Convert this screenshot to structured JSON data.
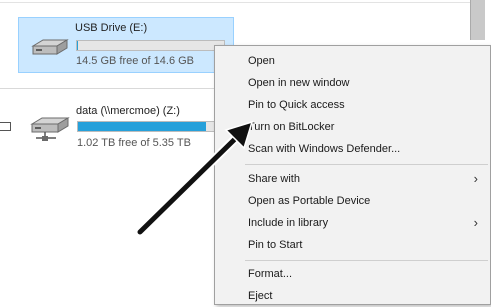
{
  "drives": [
    {
      "name": "USB Drive (E:)",
      "free_text": "14.5 GB free of 14.6 GB",
      "used_fraction": 0.01,
      "selected": true
    },
    {
      "name": "data (\\\\mercmoe) (Z:)",
      "free_text": "1.02 TB free of 5.35 TB",
      "used_fraction": 0.81,
      "selected": false
    }
  ],
  "context_menu": {
    "items": [
      {
        "label": "Open",
        "has_submenu": false
      },
      {
        "label": "Open in new window",
        "has_submenu": false
      },
      {
        "label": "Pin to Quick access",
        "has_submenu": false
      },
      {
        "label": "Turn on BitLocker",
        "has_submenu": false
      },
      {
        "label": "Scan with Windows Defender...",
        "has_submenu": false
      },
      {
        "label": "Share with",
        "has_submenu": true
      },
      {
        "label": "Open as Portable Device",
        "has_submenu": false
      },
      {
        "label": "Include in library",
        "has_submenu": true
      },
      {
        "label": "Pin to Start",
        "has_submenu": false
      },
      {
        "label": "Format...",
        "has_submenu": false
      },
      {
        "label": "Eject",
        "has_submenu": false
      }
    ]
  },
  "colors": {
    "selection_bg": "#cce8ff",
    "usage_bar": "#26a0da",
    "annotation_arrow": "#111111"
  },
  "annotation": {
    "icon": "arrow-pointing-icon",
    "target": "Turn on BitLocker"
  }
}
